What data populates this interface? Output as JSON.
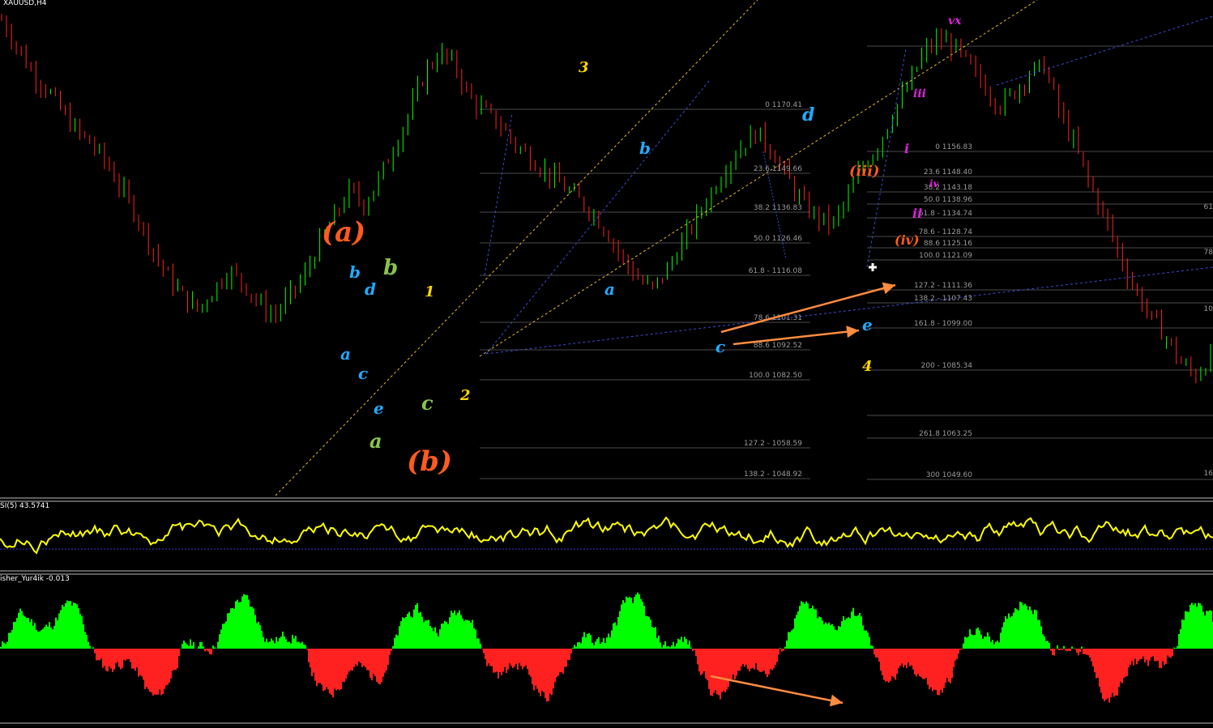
{
  "header": {
    "symbol": "XAUUSD,H4",
    "rsi_label": "SI(5) 43.5741",
    "fisher_label": "isher_Yur4ik -0.013"
  },
  "colors": {
    "up": "#00ff00",
    "down": "#ff2020",
    "rsi": "#ffff00",
    "fib": "#4a4a4a",
    "arrow": "#ff8c40"
  },
  "chart_data": {
    "type": "line",
    "series": [
      {
        "values": [
          1176,
          1168,
          1160,
          1155,
          1148,
          1142,
          1138,
          1132,
          1124,
          1116,
          1106,
          1098,
          1092,
          1088,
          1094,
          1100,
          1096,
          1090,
          1086,
          1092,
          1098,
          1108,
          1116,
          1124,
          1120,
          1128,
          1138,
          1148,
          1160,
          1166,
          1162,
          1152,
          1148,
          1144,
          1138,
          1134,
          1130,
          1126,
          1122,
          1118,
          1112,
          1104,
          1098,
          1094,
          1100,
          1108,
          1116,
          1124,
          1132,
          1138,
          1142,
          1136,
          1128,
          1120,
          1116,
          1114,
          1122,
          1132,
          1138,
          1148,
          1156,
          1166,
          1170,
          1168,
          1162,
          1156,
          1150,
          1154,
          1160,
          1162,
          1148,
          1138,
          1126,
          1116,
          1104,
          1094,
          1086,
          1080,
          1072,
          1068,
          1074
        ]
      }
    ],
    "waves": [
      {
        "label": "(a)",
        "color": "#ff5a1f"
      },
      {
        "label": "(b)",
        "color": "#ff5a1f"
      },
      {
        "label": "a",
        "color": "#22aaff"
      },
      {
        "label": "b",
        "color": "#22aaff"
      },
      {
        "label": "c",
        "color": "#22aaff"
      },
      {
        "label": "d",
        "color": "#22aaff"
      },
      {
        "label": "e",
        "color": "#22aaff"
      },
      {
        "label": "a",
        "color": "#8bc34a"
      },
      {
        "label": "b",
        "color": "#8bc34a"
      },
      {
        "label": "c",
        "color": "#8bc34a"
      },
      {
        "label": "1",
        "color": "#ffd700"
      },
      {
        "label": "2",
        "color": "#ffd700"
      },
      {
        "label": "3",
        "color": "#ffd700"
      },
      {
        "label": "4",
        "color": "#ffd700"
      },
      {
        "label": "a",
        "color": "#22aaff"
      },
      {
        "label": "b",
        "color": "#22aaff"
      },
      {
        "label": "c",
        "color": "#22aaff"
      },
      {
        "label": "d",
        "color": "#22aaff"
      },
      {
        "label": "e",
        "color": "#22aaff"
      },
      {
        "label": "(iii)",
        "color": "#ff5a1f"
      },
      {
        "label": "(iv)",
        "color": "#ff5a1f"
      },
      {
        "label": "i",
        "color": "#dd22dd"
      },
      {
        "label": "ii",
        "color": "#dd22dd"
      },
      {
        "label": "iii",
        "color": "#dd22dd"
      },
      {
        "label": "iv",
        "color": "#dd22dd"
      },
      {
        "label": "vx",
        "color": "#dd22dd"
      }
    ],
    "fib_levels_left": [
      "0 1170.41",
      "23.6 1149.66",
      "38.2 1136.83",
      "50.0 1126.46",
      "61.8 - 1116.08",
      "78.6 1101.31",
      "88.6 1092.52",
      "100.0 1082.50",
      "127.2 - 1058.59",
      "138.2 - 1048.92"
    ],
    "fib_levels_right": [
      "0 1156.83",
      "23.6 1148.40",
      "38.2 1143.18",
      "50.0 1138.96",
      "61.8 - 1134.74",
      "78.6 - 1128.74",
      "88.6 1125.16",
      "100.0 1121.09",
      "127.2 - 1111.36",
      "138.2 - 1107.43",
      "161.8 - 1099.00",
      "200 - 1085.34",
      "261.8 1063.25",
      "300 1049.60"
    ],
    "fib_levels_edge": [
      "61",
      "78",
      "10",
      "16"
    ]
  }
}
